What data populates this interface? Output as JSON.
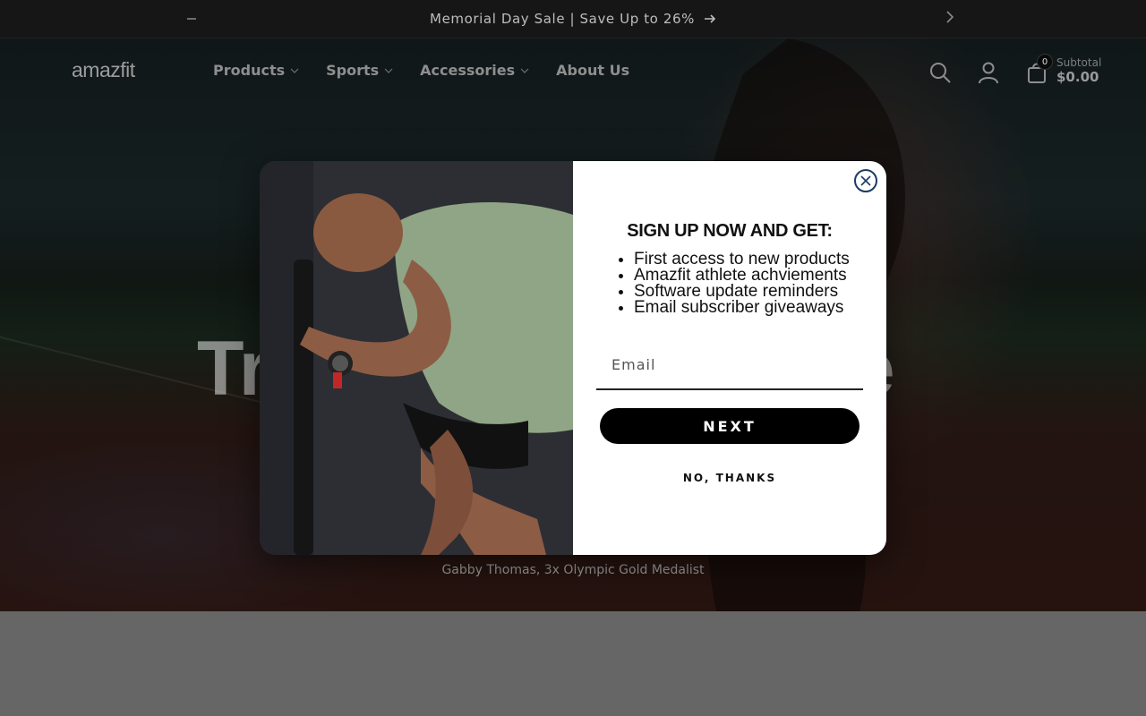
{
  "announcement": {
    "text": "Memorial Day Sale | Save Up to 26%",
    "prev_icon": "minus-icon",
    "next_icon": "chevron-right-icon",
    "arrow_icon": "arrow-right-icon"
  },
  "header": {
    "logo": "amazfit",
    "nav": [
      {
        "label": "Products",
        "has_dropdown": true
      },
      {
        "label": "Sports",
        "has_dropdown": true
      },
      {
        "label": "Accessories",
        "has_dropdown": true
      },
      {
        "label": "About Us",
        "has_dropdown": false
      }
    ],
    "cart_count": "0",
    "subtotal_label": "Subtotal",
    "subtotal_amount": "$0.00"
  },
  "hero": {
    "title_left": "Tr",
    "title_right": "re",
    "caption": "Gabby Thomas, 3x Olympic Gold Medalist"
  },
  "modal": {
    "heading": "SIGN UP NOW AND GET:",
    "benefits": [
      "First access to new products",
      "Amazfit athlete achviements",
      "Software update reminders",
      "Email subscriber giveaways"
    ],
    "email_placeholder": "Email",
    "email_value": "",
    "next_label": "NEXT",
    "decline_label": "NO, THANKS"
  },
  "colors": {
    "announce_bg": "#161616",
    "modal_button": "#000000",
    "close_ring": "#1b3a66",
    "below_bg": "#666666"
  }
}
